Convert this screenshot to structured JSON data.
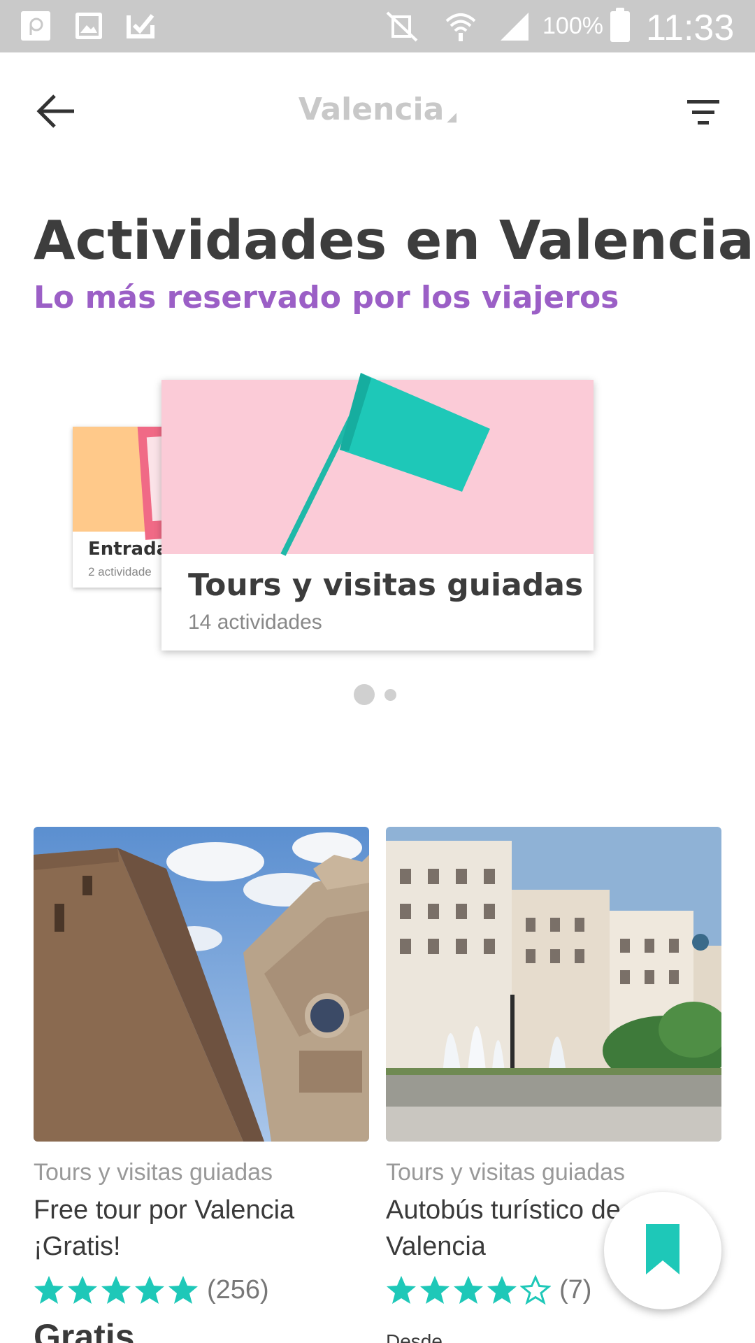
{
  "status_bar": {
    "battery": "100%",
    "time": "11:33",
    "icons": [
      "notification-p-icon",
      "image-icon",
      "check-icon",
      "mute-icon",
      "wifi-icon",
      "signal-icon",
      "battery-icon"
    ]
  },
  "app_bar": {
    "title": "Valencia",
    "back_icon": "arrow-left-icon",
    "filter_icon": "filter-icon"
  },
  "page": {
    "heading": "Actividades en Valencia",
    "subheading": "Lo más reservado por los viajeros"
  },
  "categories": [
    {
      "title": "Entrada",
      "count": "2 actividade"
    },
    {
      "title": "Tours y visitas guiadas",
      "count": "14 actividades"
    }
  ],
  "carousel": {
    "pages": 2,
    "active_page": 1
  },
  "activities": [
    {
      "category": "Tours y visitas guiadas",
      "name": "Free tour por Valencia ¡Gratis!",
      "rating": 5,
      "reviews": "(256)",
      "price": "Gratis"
    },
    {
      "category": "Tours y visitas guiadas",
      "name": "Autobús turístico de Valencia",
      "rating": 4,
      "reviews": "(7)",
      "price_prefix": "Desde"
    }
  ],
  "fab": {
    "icon": "bookmark-icon"
  },
  "colors": {
    "accent_purple": "#9b5fc6",
    "accent_teal": "#1ec8b8",
    "status_bar": "#c9c9c9",
    "card_pink": "#fbcbd7",
    "card_orange": "#ffc98a"
  }
}
